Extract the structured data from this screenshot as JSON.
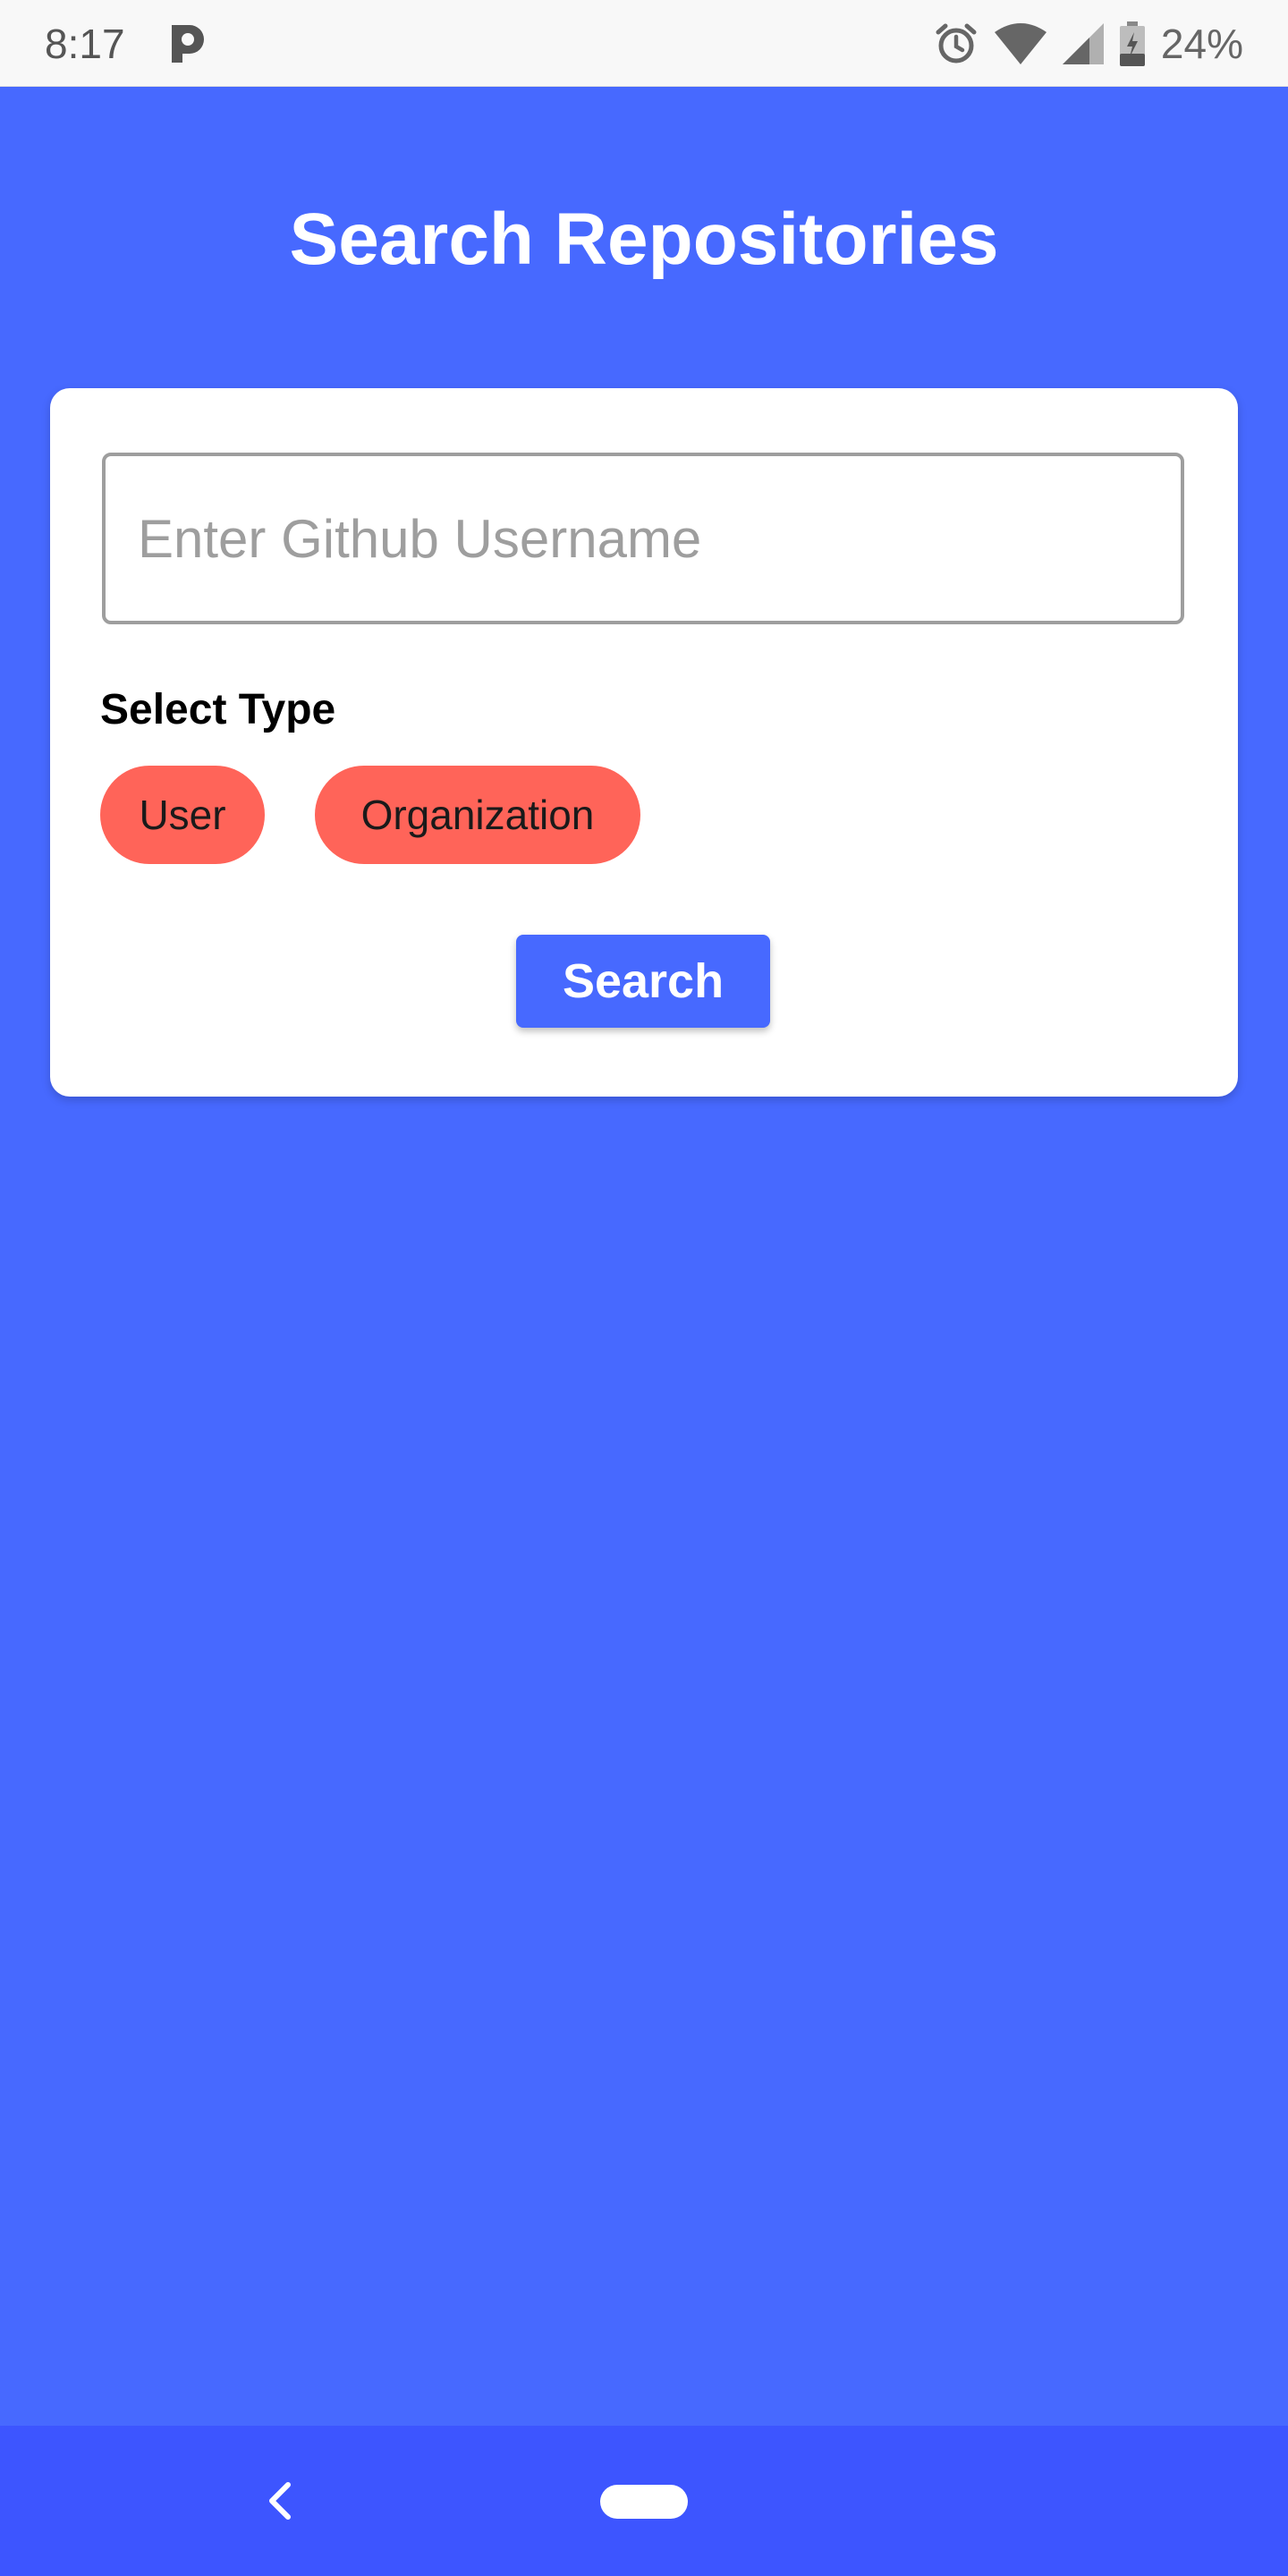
{
  "status_bar": {
    "time": "8:17",
    "app_icon": "p-icon",
    "alarm_icon": "alarm-icon",
    "wifi_icon": "wifi-icon",
    "signal_icon": "signal-icon",
    "battery_icon": "battery-charging-icon",
    "battery_percent": "24%"
  },
  "header": {
    "title": "Search Repositories"
  },
  "search_form": {
    "username_input": {
      "value": "",
      "placeholder": "Enter Github Username"
    },
    "type_label": "Select Type",
    "type_options": [
      {
        "label": "User"
      },
      {
        "label": "Organization"
      }
    ],
    "search_button_label": "Search"
  },
  "nav_bar": {
    "back_icon": "back-chevron-icon",
    "home_icon": "home-pill-icon"
  },
  "colors": {
    "primary": "#4769FF",
    "nav_bar": "#3D55FF",
    "chip": "#FF6459",
    "card": "#FFFFFF"
  }
}
